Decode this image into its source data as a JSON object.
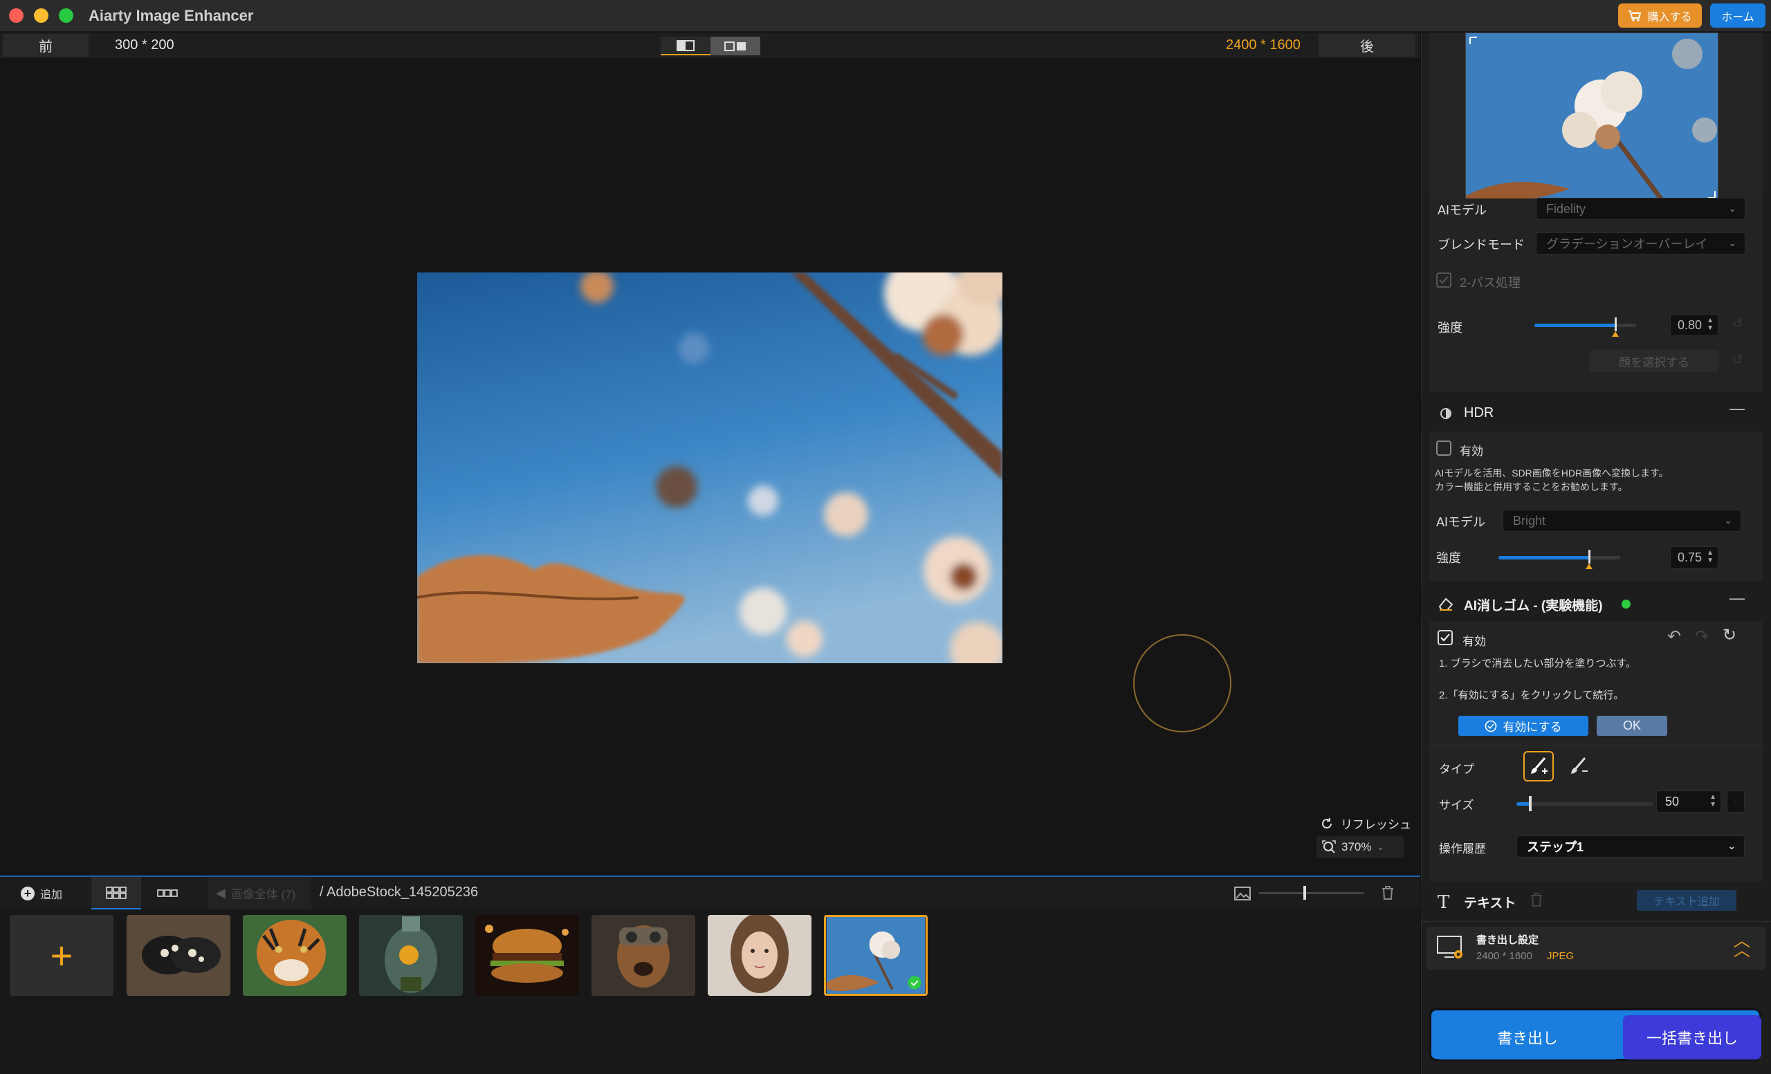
{
  "app": {
    "title": "Aiarty Image Enhancer",
    "buy_label": "購入する",
    "home_label": "ホーム"
  },
  "compare": {
    "before_label": "前",
    "before_size": "300 * 200",
    "after_size": "2400 * 1600",
    "after_label": "後"
  },
  "canvas": {
    "refresh_label": "リフレッシュ",
    "zoom": "370%"
  },
  "film": {
    "add_label": "追加",
    "all_images_label": "画像全体 (7)",
    "path": "/ AdobeStock_145205236",
    "thumbnails": [
      "butterfly",
      "tiger",
      "bottle-garden",
      "burger",
      "dog-helmet",
      "portrait",
      "cotton"
    ]
  },
  "panel": {
    "ai_model_label": "AIモデル",
    "ai_model_value": "Fidelity",
    "blend_label": "ブレンドモード",
    "blend_value": "グラデーションオーバーレイ",
    "two_pass_label": "2-パス処理",
    "strength_label": "強度",
    "strength_value": "0.80",
    "strength_fraction": 0.8,
    "face_select_label": "顔を選択する",
    "hdr": {
      "title": "HDR",
      "enable_label": "有効",
      "desc1": "AIモデルを活用、SDR画像をHDR画像へ変換します。",
      "desc2": "カラー機能と併用することをお勧めします。",
      "model_label": "AIモデル",
      "model_value": "Bright",
      "strength_label": "強度",
      "strength_value": "0.75",
      "strength_fraction": 0.75
    },
    "eraser": {
      "title": "AI消しゴム - (実験機能)",
      "enable_label": "有効",
      "step1": "1. ブラシで消去したい部分を塗りつぶす。",
      "step2": "2.「有効にする」をクリックして続行。",
      "apply_label": "有効にする",
      "ok_label": "OK",
      "type_label": "タイプ",
      "size_label": "サイズ",
      "size_value": "50",
      "size_fraction": 0.1,
      "history_label": "操作履歴",
      "history_value": "ステップ1"
    },
    "text": {
      "title": "テキスト",
      "add_label": "テキスト追加"
    },
    "export": {
      "title": "書き出し設定",
      "size": "2400 * 1600",
      "format": "JPEG",
      "export_label": "書き出し",
      "batch_label": "一括書き出し"
    }
  },
  "colors": {
    "accent_blue": "#1a7de0",
    "accent_orange": "#f0a21a",
    "green_dot": "#2ecc40"
  }
}
